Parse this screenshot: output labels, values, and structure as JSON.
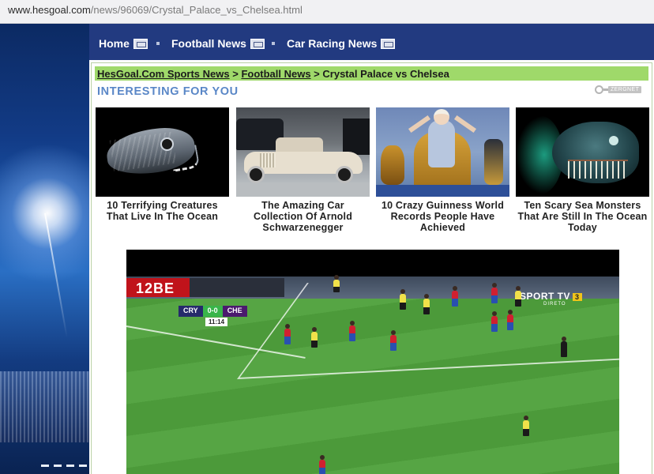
{
  "browser": {
    "url_host": "www.hesgoal.com",
    "url_path": "/news/96069/Crystal_Palace_vs_Chelsea.html"
  },
  "nav": {
    "items": [
      {
        "label": "Home",
        "icon": "home-icon"
      },
      {
        "label": "Football News",
        "icon": "football-icon"
      },
      {
        "label": "Car Racing News",
        "icon": "racing-icon"
      }
    ]
  },
  "breadcrumb": {
    "crumb1": "HesGoal.Com Sports News",
    "sep1": " > ",
    "crumb2": "Football News",
    "sep2": " > ",
    "current": "Crystal Palace vs Chelsea"
  },
  "recommend": {
    "heading": "INTERESTING FOR YOU",
    "widget_label": "ZERGNET",
    "cards": [
      {
        "caption": "10 Terrifying Creatures That Live In The Ocean",
        "image": "deep-sea-fish"
      },
      {
        "caption": "The Amazing Car Collection Of Arnold Schwarzenegger",
        "image": "vintage-car"
      },
      {
        "caption": "10 Crazy Guinness World Records People Have Achieved",
        "image": "woman-on-throne"
      },
      {
        "caption": "Ten Scary Sea Monsters That Are Still In The Ocean Today",
        "image": "sea-monster"
      }
    ]
  },
  "video": {
    "adboard": "12BE",
    "scoreboard": {
      "home": "CRY",
      "score": "0-0",
      "away": "CHE",
      "clock": "11:14"
    },
    "broadcaster": "SPORT TV",
    "channel": "3",
    "broadcaster_sub": "DIRETO"
  },
  "colors": {
    "nav_bg": "#223a80",
    "breadcrumb_bg": "#9fd96a",
    "heading": "#5a87c7",
    "pitch": "#4c9a3a"
  }
}
